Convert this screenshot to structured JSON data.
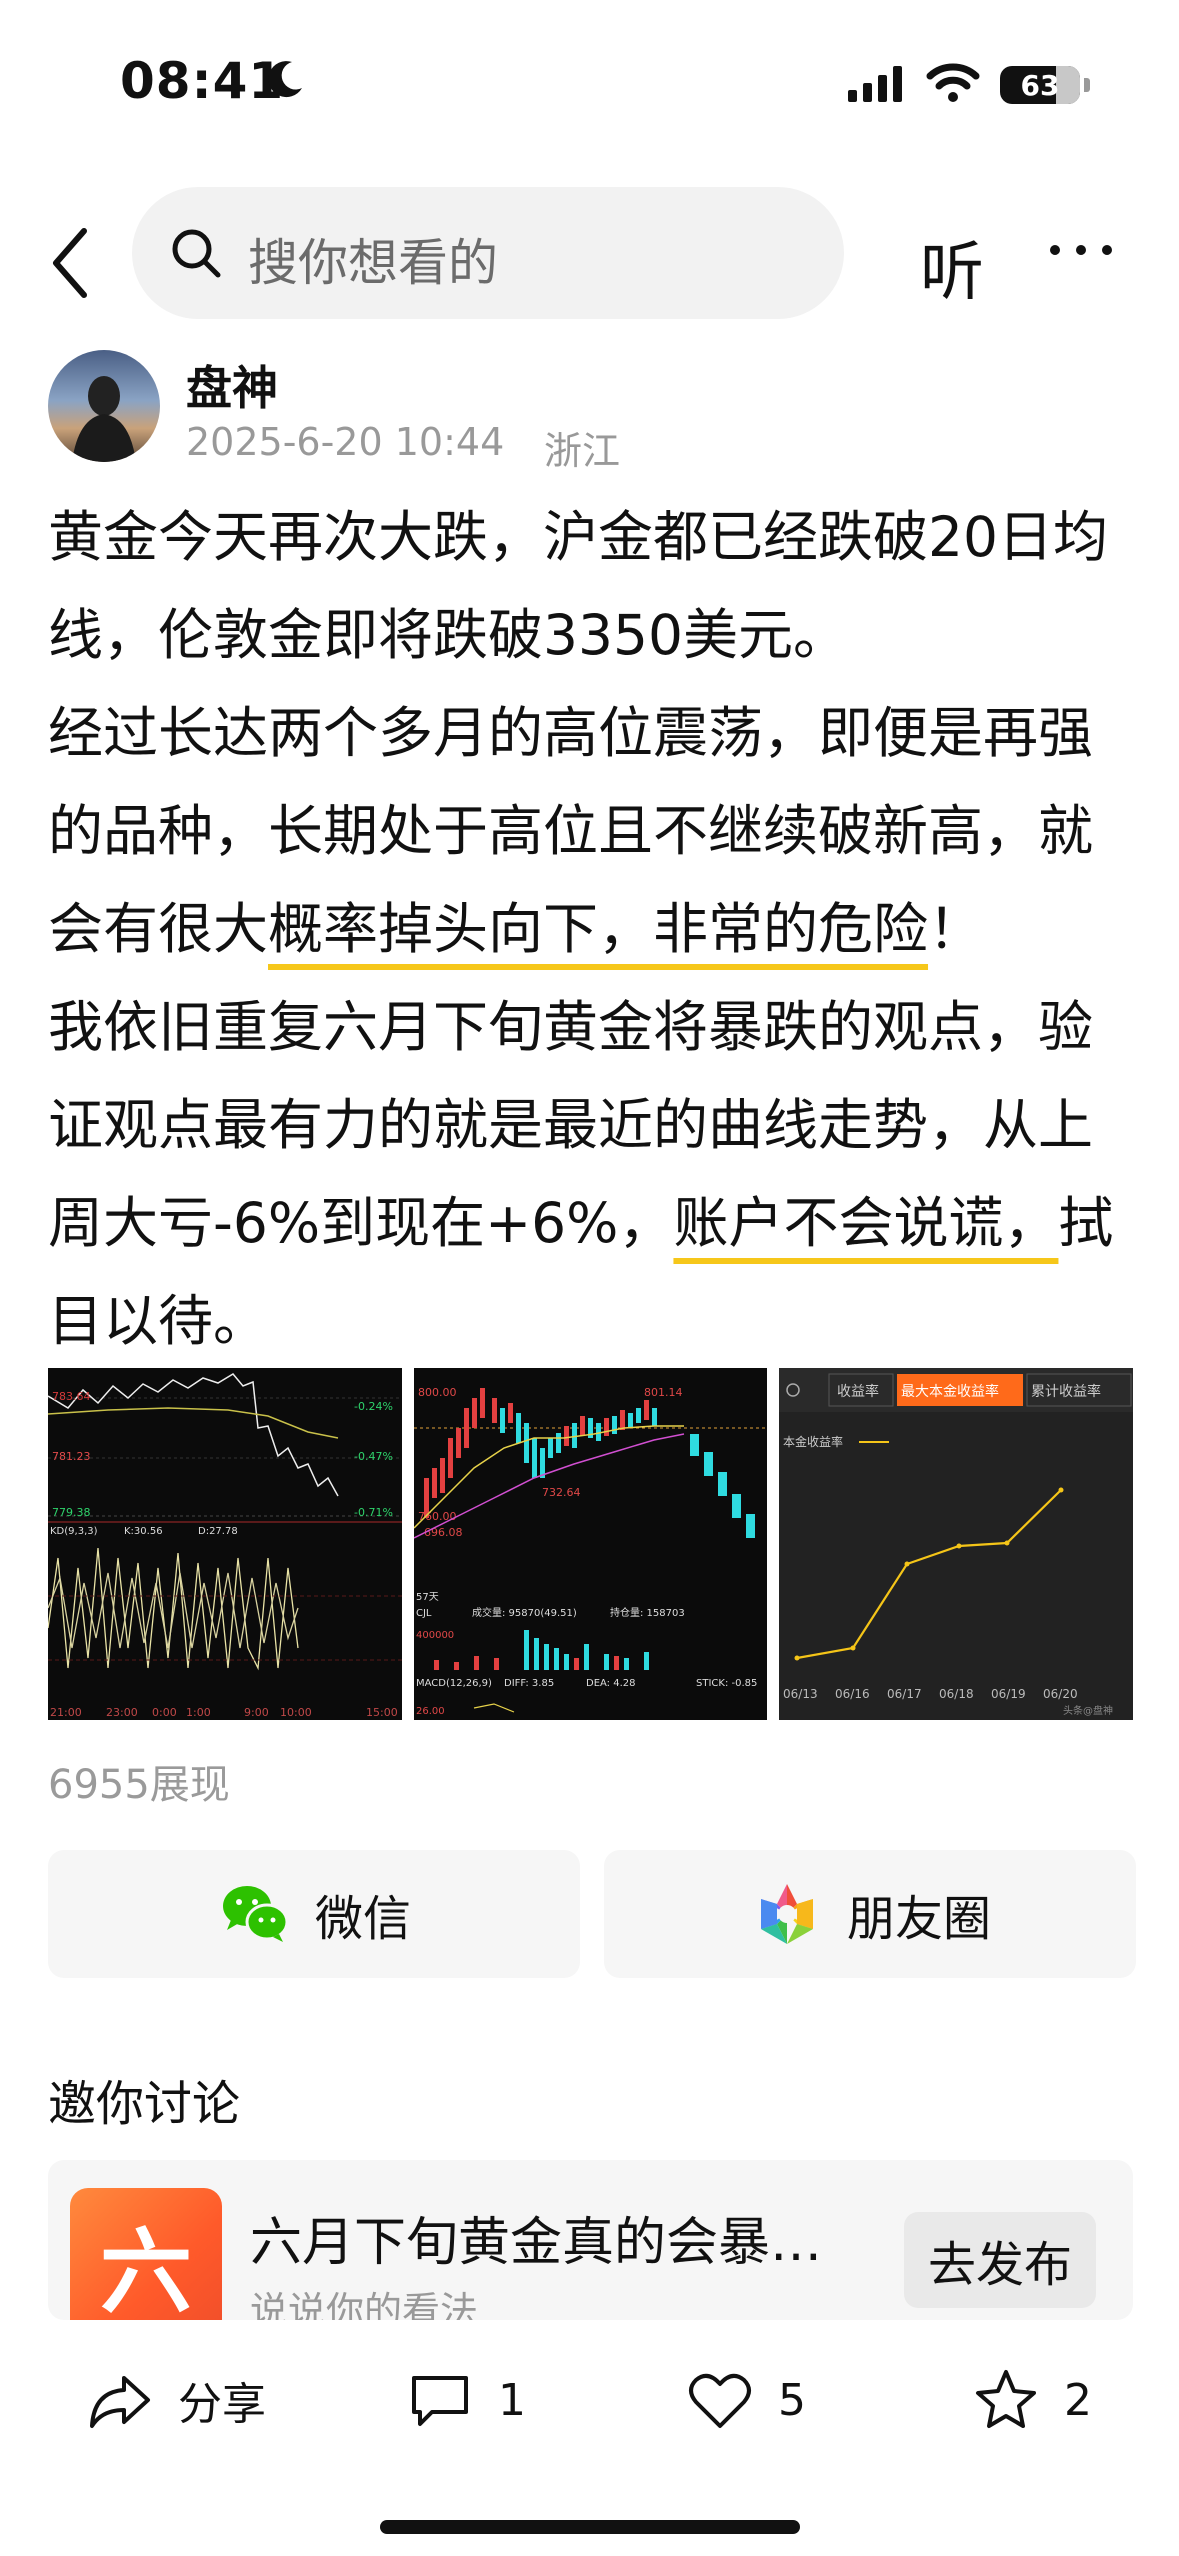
{
  "status_bar": {
    "time": "08:41",
    "battery": "63"
  },
  "nav": {
    "search_placeholder": "搜你想看的",
    "listen_label": "听"
  },
  "author": {
    "name": "盘神",
    "time": "2025-6-20 10:44",
    "location": "浙江"
  },
  "post": {
    "p1": "黄金今天再次大跌，沪金都已经跌破20日均线，伦敦金即将跌破3350美元。",
    "p2_a": "经过长达两个多月的高位震荡，即便是再强的品种，长期处于高位且不继续破新高，就会有很大",
    "p2_hl": "概率掉头向下，非常的危险",
    "p2_b": "！",
    "p3_a": "我依旧重复六月下旬黄金将暴跌的观点，验证观点最有力的就是最近的曲线走势，从上周大亏-6%到现在+6%，",
    "p3_hl": "账户不会说谎，",
    "p3_b": "拭目以待。"
  },
  "images": {
    "img1": {
      "l1": "783.64",
      "l2": "781.23",
      "l3": "779.38",
      "r1": "-0.24%",
      "r2": "-0.47%",
      "r3": "-0.71%",
      "kd": "KD(9,3,3)",
      "k": "K:30.56",
      "d": "D:27.78",
      "t1": "21:00",
      "t2": "23:00",
      "t3": "0:00",
      "t4": "1:00",
      "t5": "9:00",
      "t6": "10:00",
      "t7": "15:00"
    },
    "img2": {
      "p1": "800.00",
      "p2": "801.14",
      "p3": "732.64",
      "p4": "696.08",
      "p5": "760.00",
      "d57": "57天",
      "cjl": "CJL",
      "vol": "成交量: 95870(49.51)",
      "oi": "持仓量: 158703",
      "v4": "400000",
      "macd": "MACD(12,26,9)",
      "diff": "DIFF: 3.85",
      "dea": "DEA: 4.28",
      "stick": "STICK: -0.85",
      "v26": "26.00"
    },
    "img3": {
      "tab1": "收益率",
      "tab2": "最大本金收益率",
      "tab3": "累计收益率",
      "legend": "本金收益率",
      "dates": [
        "06/13",
        "06/16",
        "06/17",
        "06/18",
        "06/19",
        "06/20"
      ],
      "watermark": "头条@盘神"
    }
  },
  "stats": {
    "impressions": "6955展现"
  },
  "share": {
    "wechat": "微信",
    "moments": "朋友圈"
  },
  "discuss": {
    "title": "邀你讨论",
    "thumb": "六",
    "topic": "六月下旬黄金真的会暴…",
    "sub": "说说你的看法",
    "publish": "去发布"
  },
  "actions": {
    "share": "分享",
    "comments": "1",
    "likes": "5",
    "favorites": "2"
  },
  "colors": {
    "accent_underline": "#f6c71a",
    "wechat_green": "#2dc100",
    "topic_orange": "#ff5a2a"
  }
}
